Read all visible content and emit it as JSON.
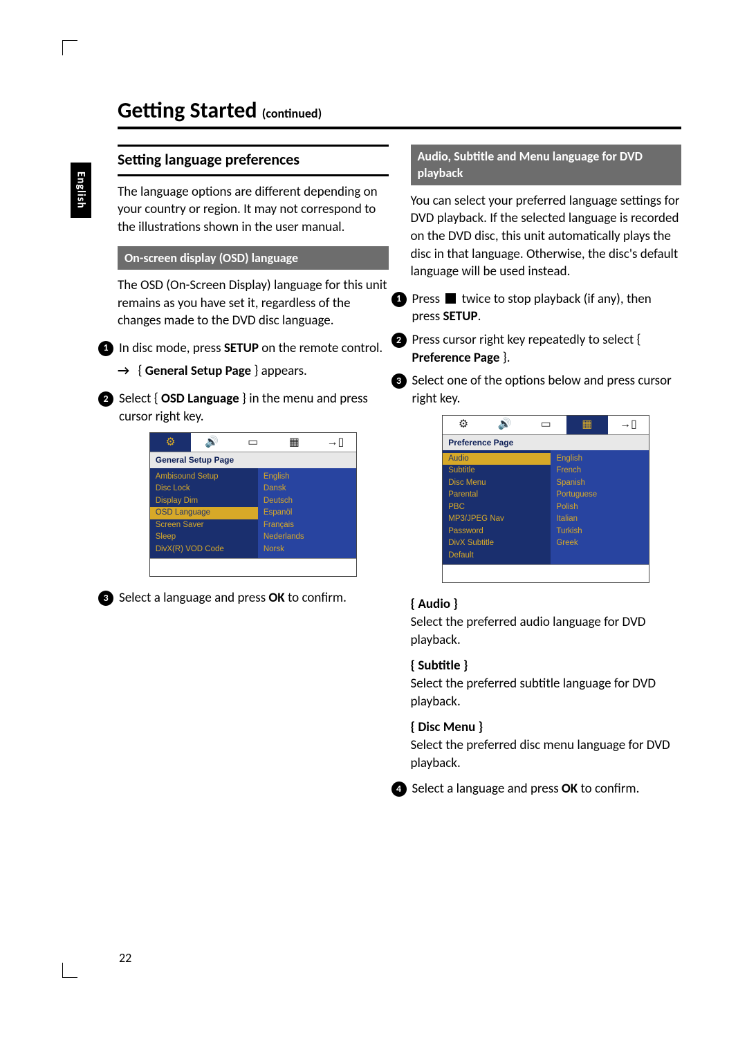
{
  "side_tab": "English",
  "page_number": "22",
  "title_main": "Getting Started",
  "title_cont": "(continued)",
  "left": {
    "section_heading": "Setting language preferences",
    "intro": "The language options are different depending on your country or region.  It may not correspond to the illustrations shown in the user manual.",
    "osd_bar": "On-screen display (OSD) language",
    "osd_para": "The OSD (On-Screen Display) language for this unit remains as you have set it, regardless of the changes made to the DVD disc language.",
    "step1a": "In disc mode, press ",
    "step1b": "SETUP",
    "step1c": " on the remote control.",
    "arrow_a": "{ ",
    "arrow_b": "General Setup Page",
    "arrow_c": " } appears.",
    "step2a": "Select { ",
    "step2b": "OSD Language",
    "step2c": " } in the menu and press cursor right key.",
    "step3a": "Select a language and press ",
    "step3b": "OK",
    "step3c": " to confirm.",
    "osd_shot": {
      "header": "General Setup Page",
      "left_items": [
        "Ambisound Setup",
        "Disc Lock",
        "Display Dim",
        "OSD Language",
        "Screen Saver",
        "Sleep",
        "DivX(R) VOD Code"
      ],
      "right_items": [
        "English",
        "Dansk",
        "Deutsch",
        "Espanöl",
        "Français",
        "Nederlands",
        "Norsk"
      ],
      "selected_left_index": 3
    }
  },
  "right": {
    "bar": "Audio, Subtitle and Menu language for DVD playback",
    "intro": "You can select your preferred language settings for DVD playback.  If the selected language is recorded on the DVD disc, this unit automatically plays the disc in that language.  Otherwise, the disc's default language will be used instead.",
    "step1a": "Press ",
    "step1b": " twice to stop playback (if any), then press ",
    "step1c": "SETUP",
    "step1d": ".",
    "step2a": "Press cursor right key repeatedly to select { ",
    "step2b": "Preference Page",
    "step2c": " }.",
    "step3": "Select one of the options below and press cursor right key.",
    "osd_shot": {
      "header": "Preference Page",
      "left_items": [
        "Audio",
        "Subtitle",
        "Disc Menu",
        "Parental",
        "PBC",
        "MP3/JPEG Nav",
        "Password",
        "DivX Subtitle",
        "Default"
      ],
      "right_items": [
        "English",
        "French",
        "Spanish",
        "Portuguese",
        "Polish",
        "Italian",
        "Turkish",
        "Greek"
      ],
      "selected_left_index": 0
    },
    "opts": [
      {
        "title": "{ Audio }",
        "body": "Select the preferred audio language for DVD playback."
      },
      {
        "title": "{ Subtitle }",
        "body": "Select the preferred subtitle language for DVD playback."
      },
      {
        "title": "{ Disc Menu }",
        "body": "Select the preferred disc menu language for DVD playback."
      }
    ],
    "step4a": "Select a language and press ",
    "step4b": "OK",
    "step4c": " to confirm."
  },
  "osd_tab_icons": [
    "⚙",
    "🔊",
    "▭",
    "▦",
    "→▯"
  ]
}
